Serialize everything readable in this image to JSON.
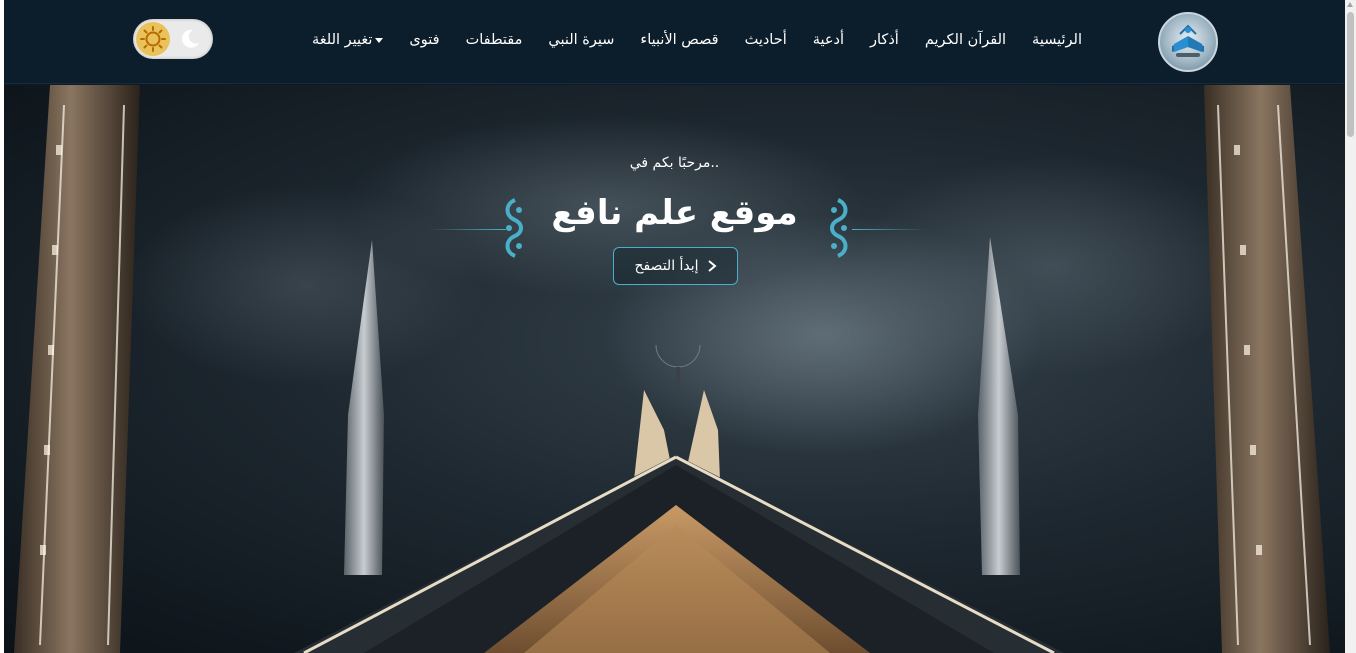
{
  "nav": {
    "items": [
      {
        "label": "الرئيسية",
        "name": "nav-home"
      },
      {
        "label": "القرآن الكريم",
        "name": "nav-quran"
      },
      {
        "label": "أذكار",
        "name": "nav-adhkar"
      },
      {
        "label": "أدعية",
        "name": "nav-duas"
      },
      {
        "label": "أحاديث",
        "name": "nav-hadiths"
      },
      {
        "label": "قصص الأنبياء",
        "name": "nav-prophets-stories"
      },
      {
        "label": "سيرة النبي",
        "name": "nav-prophet-biography"
      },
      {
        "label": "مقتطفات",
        "name": "nav-excerpts"
      },
      {
        "label": "فتوى",
        "name": "nav-fatwa"
      }
    ],
    "language_label": "تغيير اللغة"
  },
  "theme_toggle": {
    "icons": [
      "sun-icon",
      "moon-icon"
    ],
    "mode": "light"
  },
  "hero": {
    "welcome": "مرحبًا بكم في..",
    "title": "موقع علم نافع",
    "cta_label": "إبدأ التصفح"
  },
  "colors": {
    "navbar": "#0c1d2b",
    "accent": "#4aafc8",
    "text": "#ffffff",
    "sun": "#e9c25c"
  }
}
